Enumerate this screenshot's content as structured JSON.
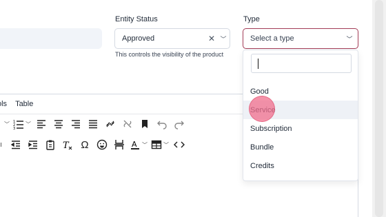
{
  "fields": {
    "entity_status": {
      "label": "Entity Status",
      "value": "Approved",
      "help": "This controls the visibility of the product"
    },
    "type": {
      "label": "Type",
      "placeholder": "Select a type",
      "options": [
        "Good",
        "Service",
        "Subscription",
        "Bundle",
        "Credits"
      ],
      "hovered_option": "Service"
    }
  },
  "editor": {
    "menubar": [
      "ols",
      "Table"
    ],
    "toolbar_row1_icons": [
      "bullet-list-caret-icon",
      "numbered-list-icon",
      "align-left-icon",
      "align-center-icon",
      "align-right-icon",
      "align-justify-icon",
      "link-icon",
      "unlink-icon",
      "bookmark-icon",
      "undo-icon",
      "redo-icon"
    ],
    "toolbar_row2_icons": [
      "indent-partial-icon",
      "outdent-icon",
      "indent-icon",
      "paste-icon",
      "clear-format-icon",
      "omega-icon",
      "emoji-icon",
      "page-break-icon",
      "text-color-icon",
      "table-icon",
      "code-icon"
    ]
  },
  "colors": {
    "accent": "#a23a55",
    "input_bg": "#f1f4f9",
    "hover_bg": "#eef1f6",
    "click_indicator": "#f06e8c"
  }
}
